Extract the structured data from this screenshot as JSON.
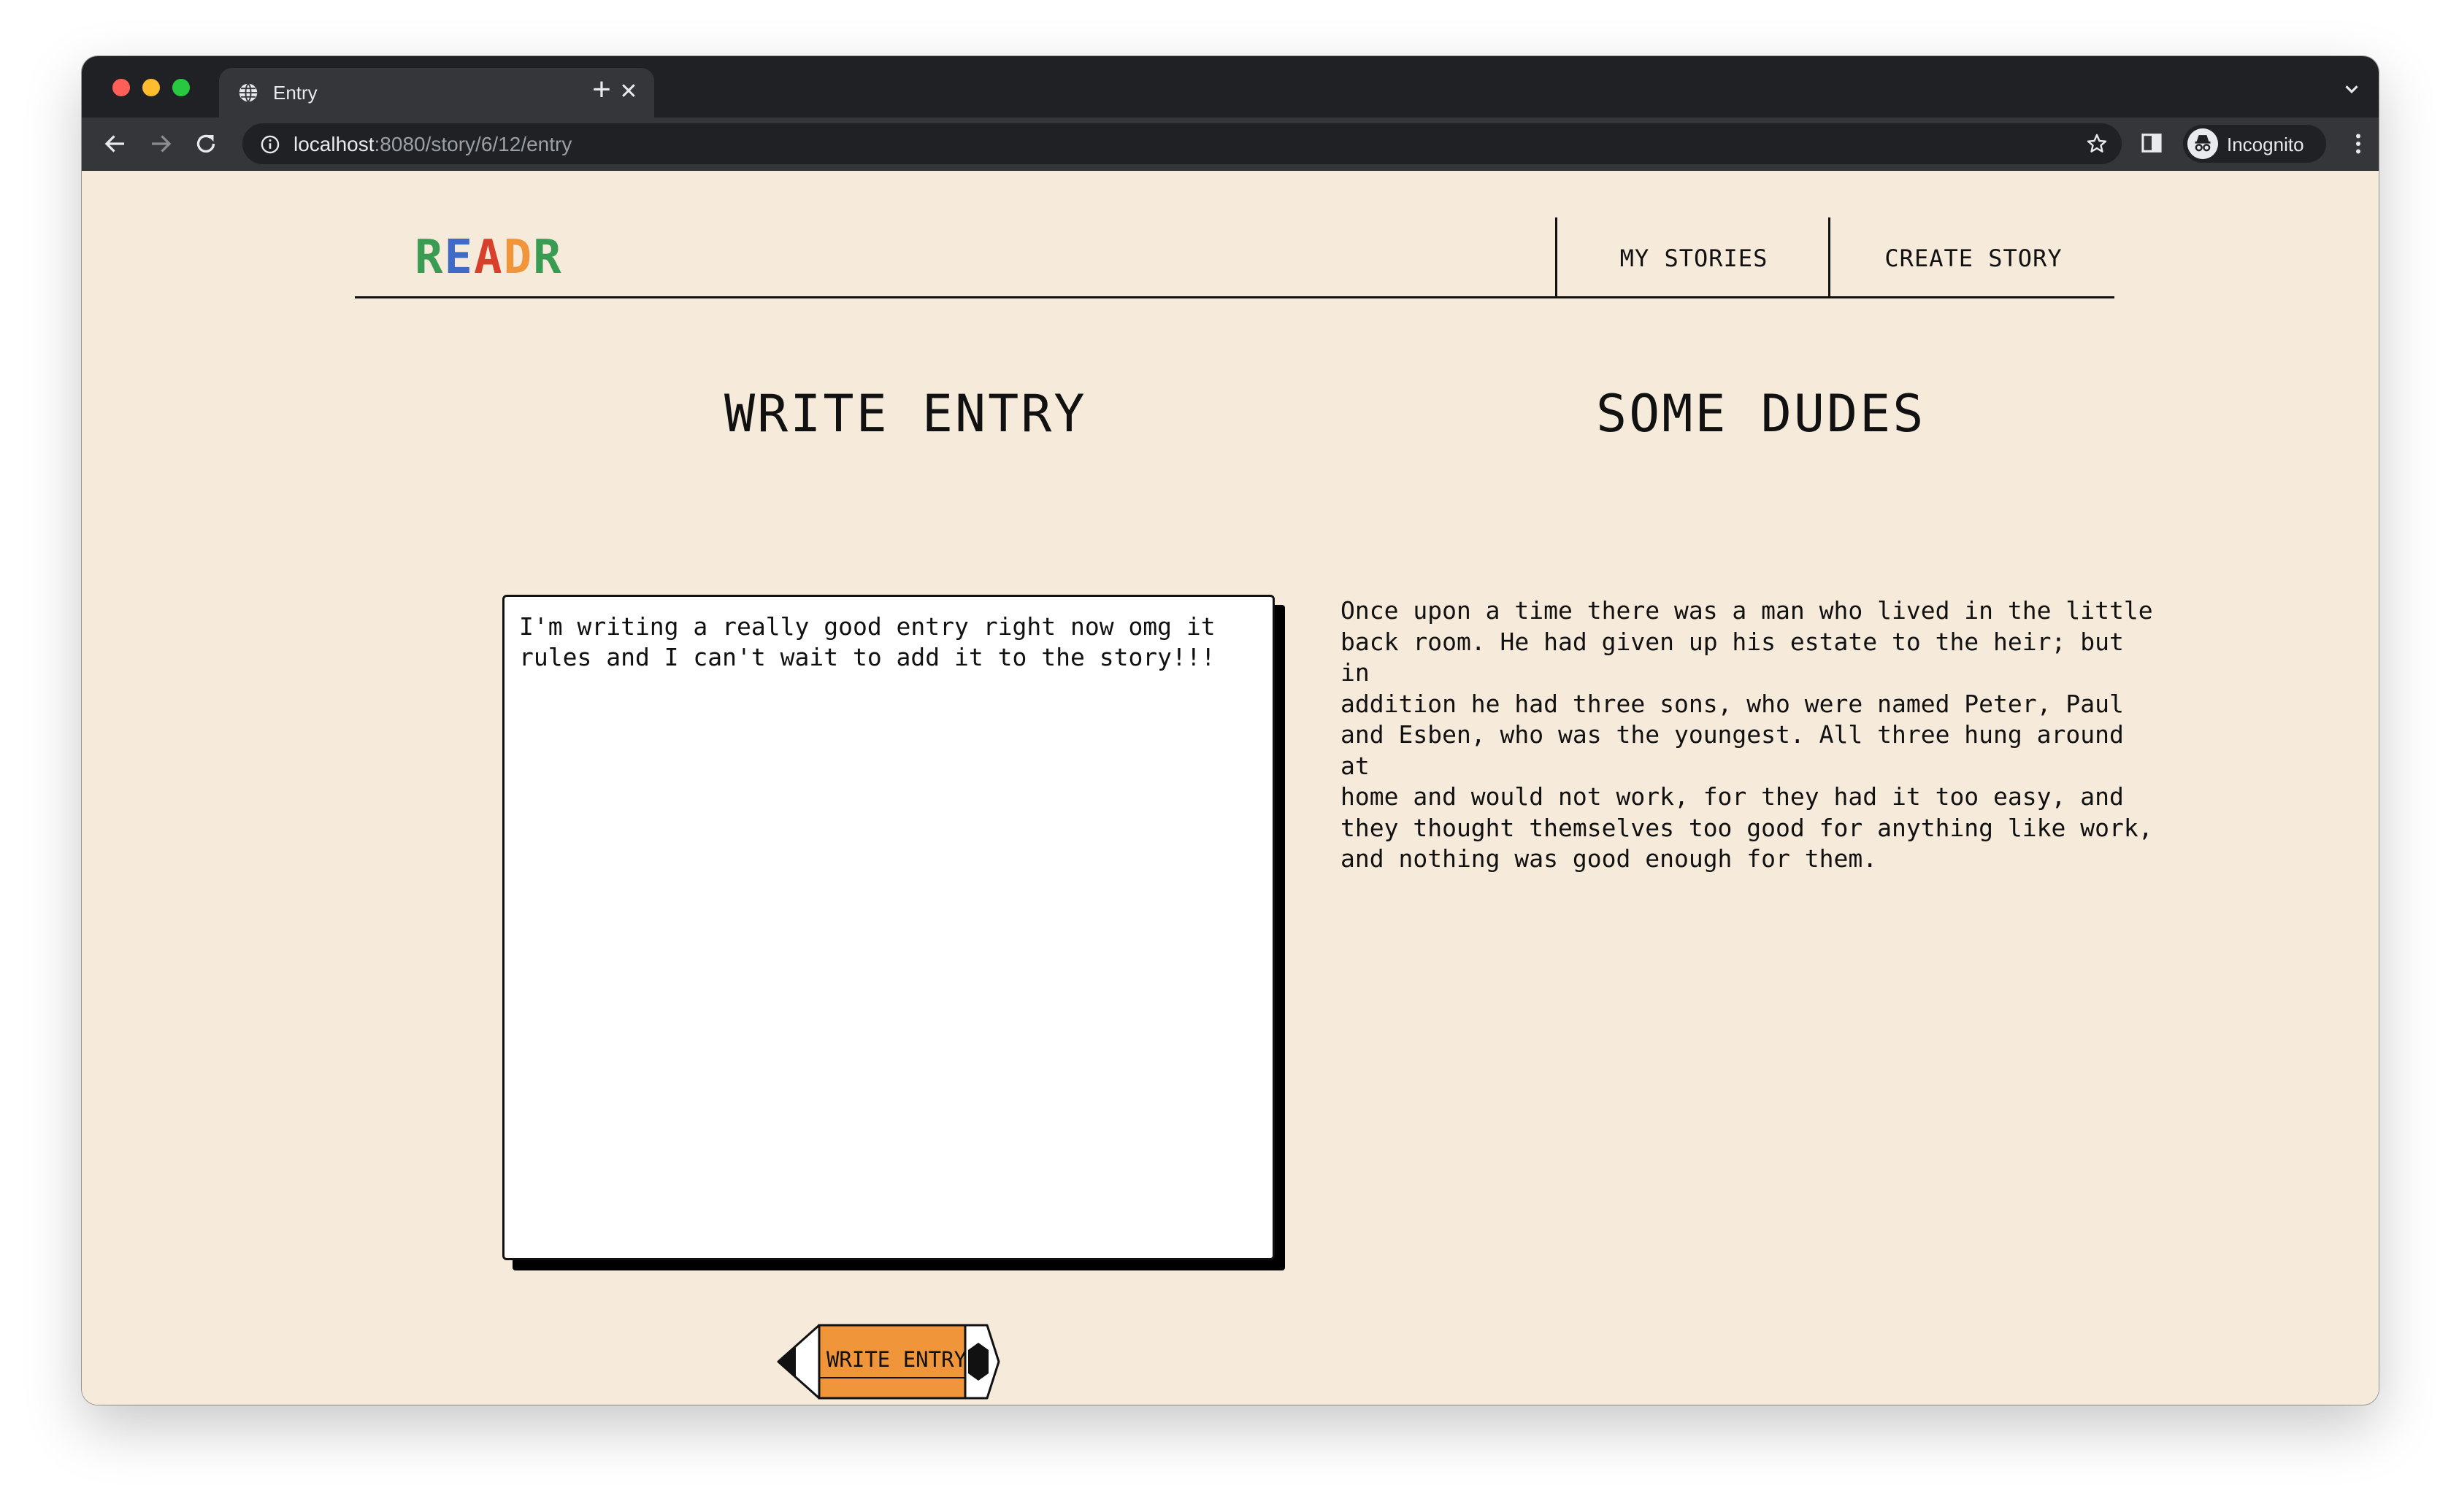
{
  "browser": {
    "tab_title": "Entry",
    "url_host": "localhost",
    "url_path": ":8080/story/6/12/entry",
    "profile_label": "Incognito"
  },
  "site": {
    "logo_letters": [
      {
        "char": "R",
        "color": "#3a9b52"
      },
      {
        "char": "E",
        "color": "#4169c8"
      },
      {
        "char": "A",
        "color": "#d8402c"
      },
      {
        "char": "D",
        "color": "#f0953a"
      },
      {
        "char": "R",
        "color": "#3a9b52"
      }
    ],
    "nav": {
      "my_stories": "MY STORIES",
      "create_story": "CREATE STORY"
    }
  },
  "write": {
    "heading": "WRITE ENTRY",
    "entry_text": "I'm writing a really good entry right now omg it\nrules and I can't wait to add it to the story!!!",
    "button_label": "WRITE ENTRY",
    "button_color": "#f0953a"
  },
  "story": {
    "title": "SOME DUDES",
    "text": "Once upon a time there was a man who lived in the little\nback room. He had given up his estate to the heir; but in\naddition he had three sons, who were named Peter, Paul\nand Esben, who was the youngest. All three hung around at\nhome and would not work, for they had it too easy, and\nthey thought themselves too good for anything like work,\nand nothing was good enough for them."
  }
}
